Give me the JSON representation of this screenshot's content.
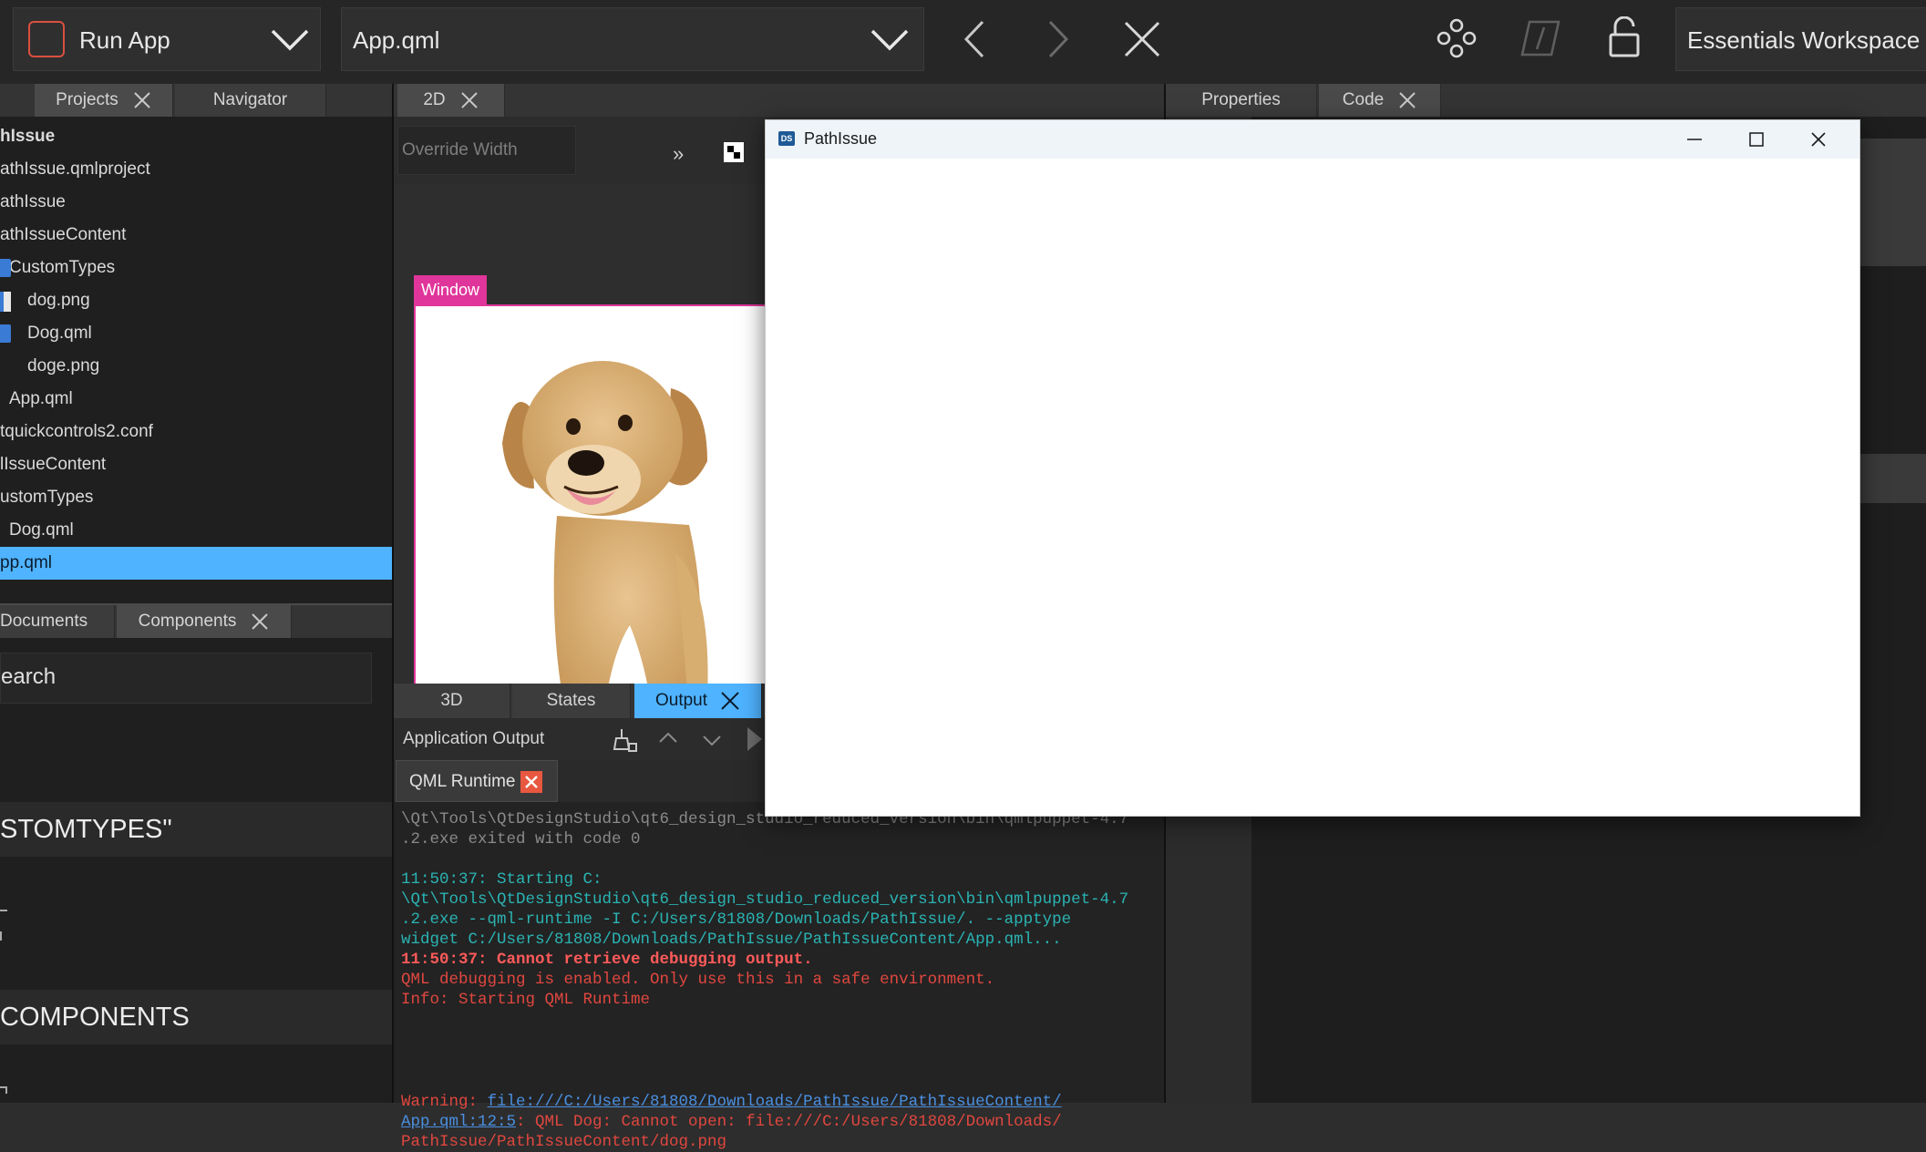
{
  "toolbar": {
    "run_label": "Run App",
    "document": "App.qml",
    "workspace": "Essentials Workspace"
  },
  "left_panel": {
    "tabs": [
      "Projects",
      "Navigator"
    ],
    "tree": [
      "hIssue",
      "athIssue.qmlproject",
      "athIssue",
      "athIssueContent",
      "CustomTypes",
      "dog.png",
      "Dog.qml",
      "doge.png",
      "App.qml",
      "tquickcontrols2.conf",
      "lIssueContent",
      "ustomTypes",
      "Dog.qml",
      "pp.qml"
    ],
    "bottom_tabs": [
      "Documents",
      "Components"
    ],
    "search_placeholder": "earch",
    "section1": "STOMTYPES\"",
    "section2": "COMPONENTS"
  },
  "center": {
    "tab": "2D",
    "override_width": "Override Width",
    "window_label": "Window",
    "bottom_tabs": [
      "3D",
      "States",
      "Output"
    ],
    "app_output_label": "Application Output",
    "runtime_tab": "QML Runtime",
    "log": [
      {
        "text": "\\Qt\\Tools\\QtDesignStudio\\qt6_design_studio_reduced_version\\bin\\qmlpuppet-4.7",
        "color": "#8a8a8a",
        "bold": false
      },
      {
        "text": ".2.exe exited with code 0",
        "color": "#8a8a8a",
        "bold": false
      },
      {
        "text": "",
        "color": "#8a8a8a",
        "bold": false
      },
      {
        "text": "11:50:37: Starting C:",
        "color": "#2bb3b3",
        "bold": false
      },
      {
        "text": "\\Qt\\Tools\\QtDesignStudio\\qt6_design_studio_reduced_version\\bin\\qmlpuppet-4.7",
        "color": "#2bb3b3",
        "bold": false
      },
      {
        "text": ".2.exe --qml-runtime -I C:/Users/81808/Downloads/PathIssue/. --apptype",
        "color": "#2bb3b3",
        "bold": false
      },
      {
        "text": "widget C:/Users/81808/Downloads/PathIssue/PathIssueContent/App.qml...",
        "color": "#2bb3b3",
        "bold": false
      },
      {
        "text": "11:50:37: Cannot retrieve debugging output.",
        "color": "#ff5a5a",
        "bold": true
      },
      {
        "text": "QML debugging is enabled. Only use this in a safe environment.",
        "color": "#e0473f",
        "bold": false
      },
      {
        "text": "Info: Starting QML Runtime",
        "color": "#e0473f",
        "bold": false
      }
    ],
    "warning_prefix": "Warning: ",
    "warning_link1": "file:///C:/Users/81808/Downloads/PathIssue/PathIssueContent/",
    "warning_link2": "App.qml:12:5",
    "warning_rest": ": QML Dog: Cannot open: file:///C:/Users/81808/Downloads/",
    "warning_last": "PathIssue/PathIssueContent/dog.png"
  },
  "right_panel": {
    "tabs": [
      "Properties",
      "Code"
    ]
  },
  "popup": {
    "title": "PathIssue",
    "app_badge": "DS"
  },
  "colors": {
    "accent": "#4fb3ff",
    "window_tag": "#e0359a",
    "error": "#e0473f",
    "info": "#2bb3b3"
  }
}
